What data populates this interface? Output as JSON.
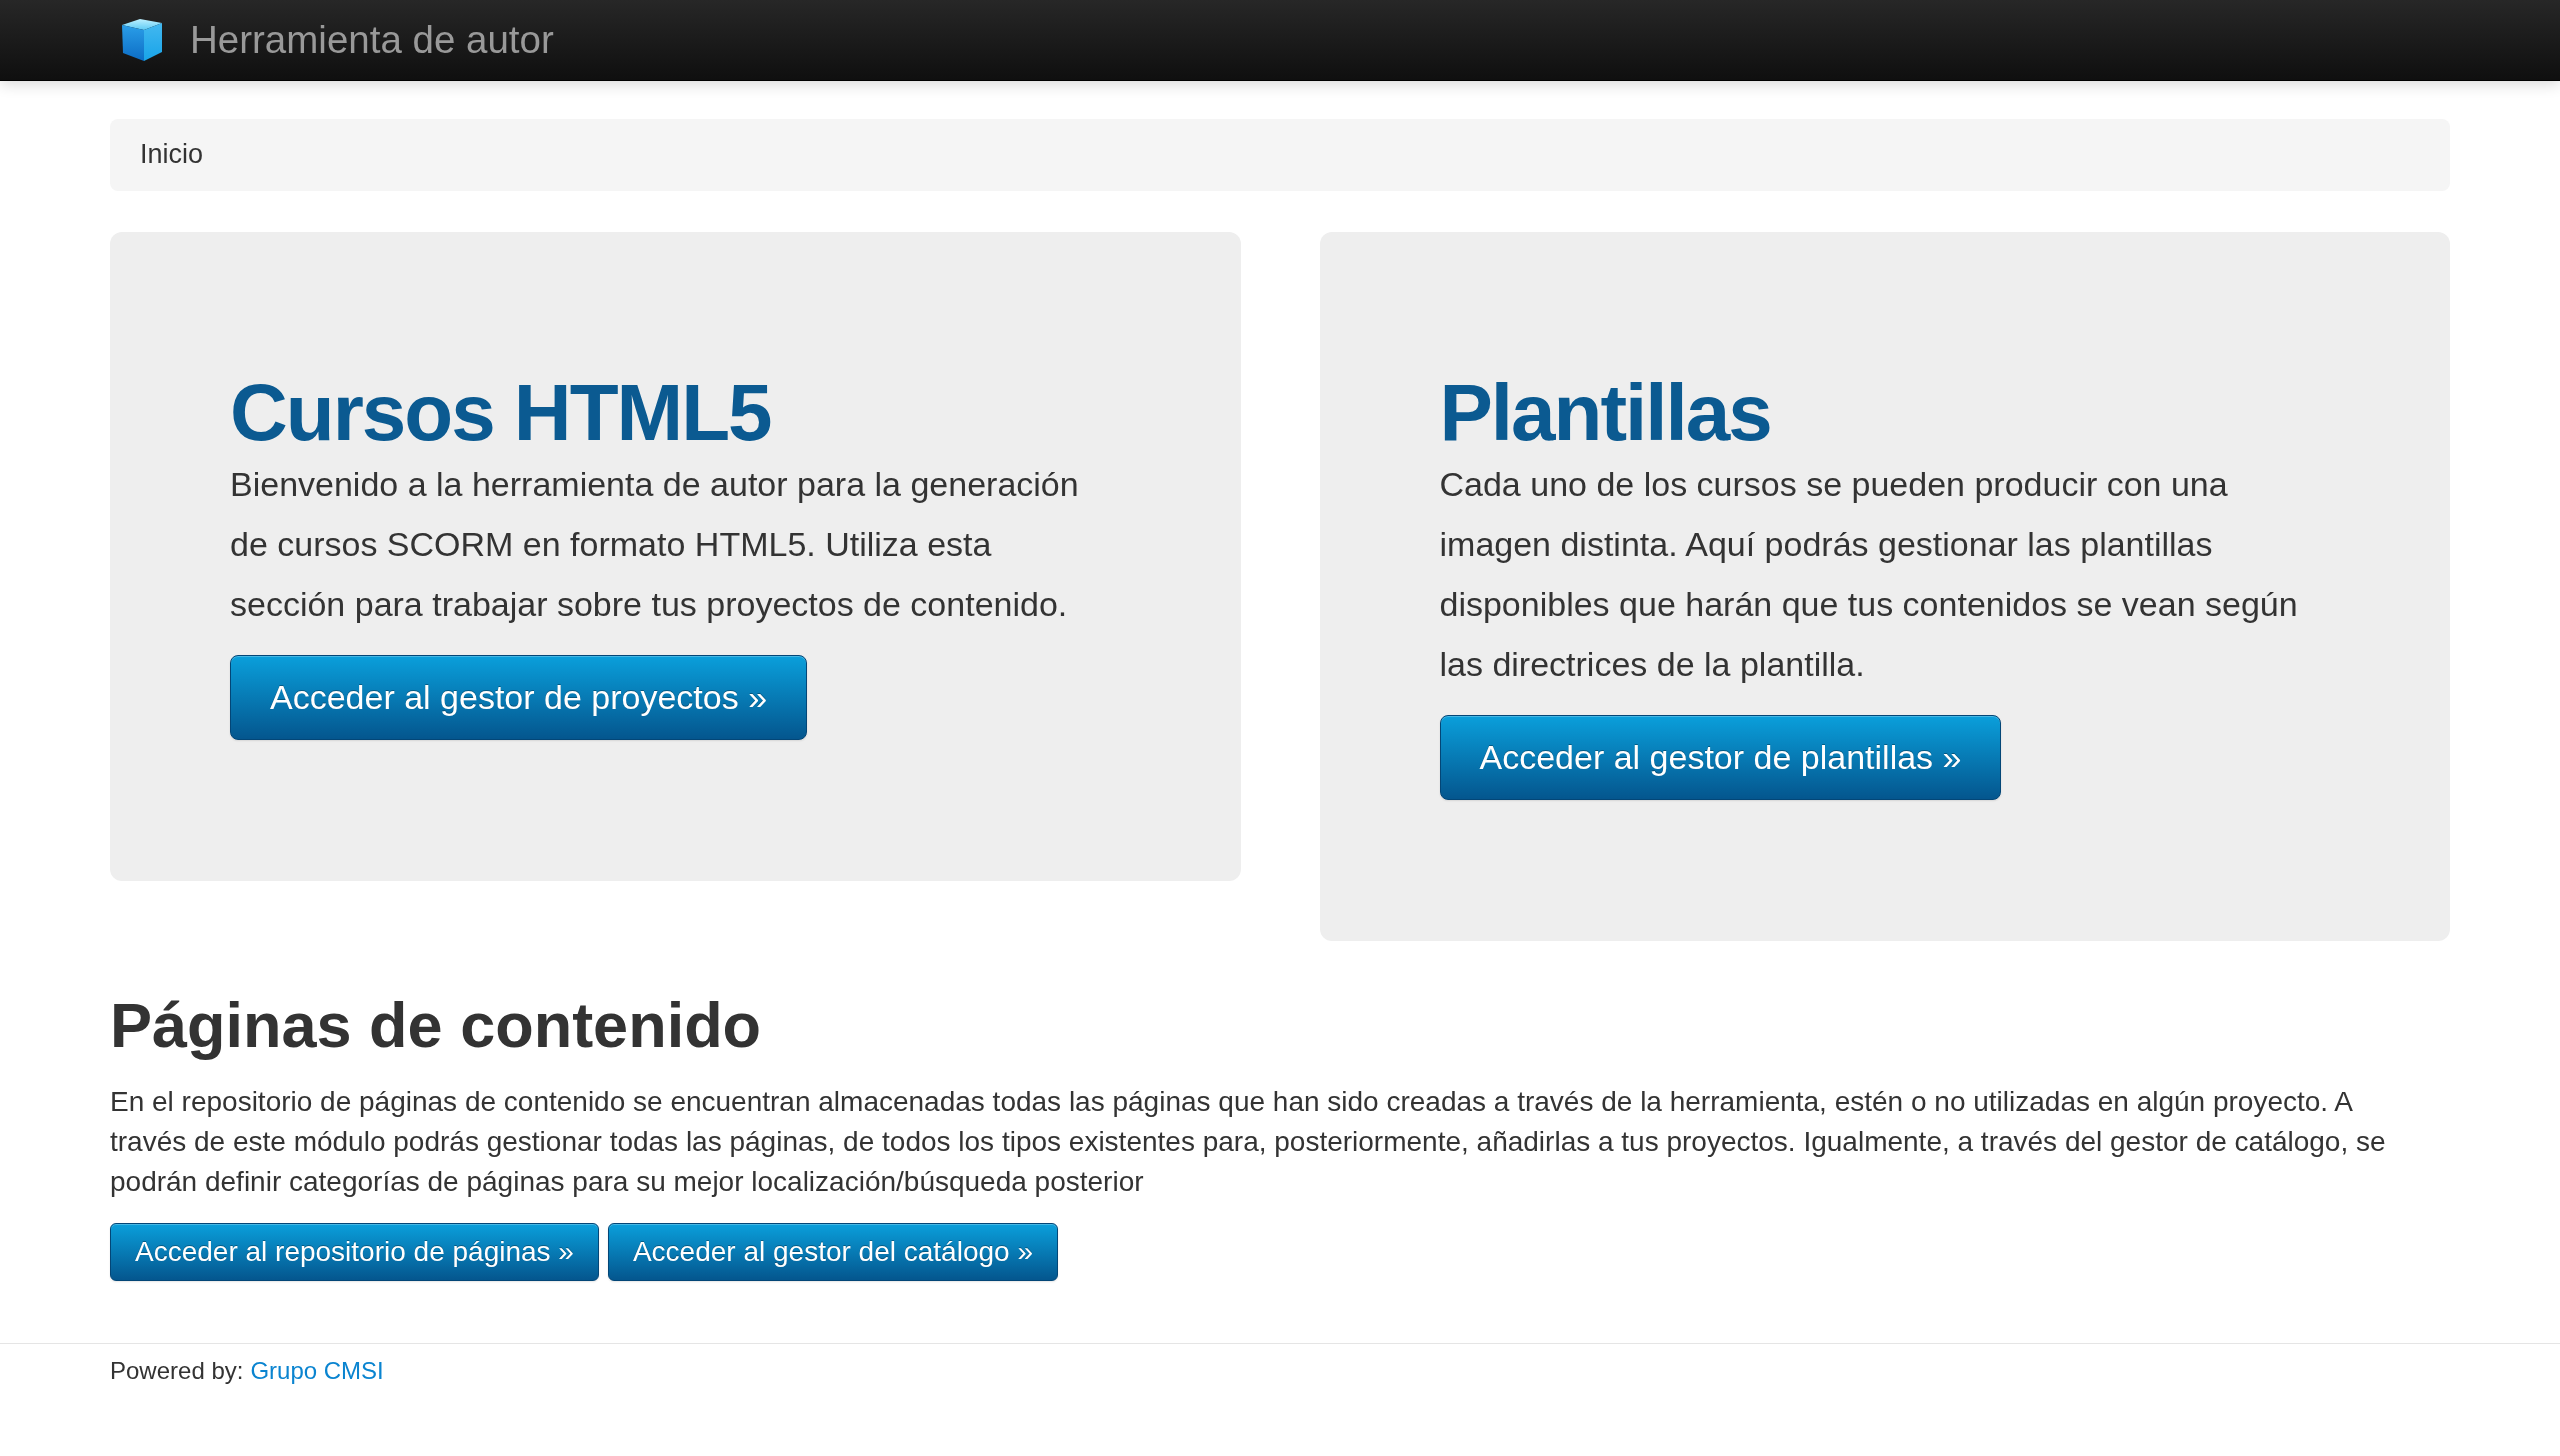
{
  "navbar": {
    "brand": "Herramienta de autor"
  },
  "breadcrumb": [
    "Inicio"
  ],
  "hero_units": [
    {
      "title": "Cursos HTML5",
      "text": "Bienvenido a la herramienta de autor para la generación de cursos SCORM en formato HTML5. Utiliza esta sección para trabajar sobre tus proyectos de contenido.",
      "button": "Acceder al gestor de proyectos »"
    },
    {
      "title": "Plantillas",
      "text": "Cada uno de los cursos se pueden producir con una imagen distinta. Aquí podrás gestionar las plantillas disponibles que harán que tus contenidos se vean según las directrices de la plantilla.",
      "button": "Acceder al gestor de plantillas »"
    }
  ],
  "section": {
    "title": "Páginas de contenido",
    "text": "En el repositorio de páginas de contenido se encuentran almacenadas todas las páginas que han sido creadas a través de la herramienta, estén o no utilizadas en algún proyecto. A través de este módulo podrás gestionar todas las páginas, de todos los tipos existentes para, posteriormente, añadirlas a tus proyectos. Igualmente, a través del gestor de catálogo, se podrán definir categorías de páginas para su mejor localización/búsqueda posterior",
    "buttons": [
      "Acceder al repositorio de páginas »",
      "Acceder al gestor del catálogo »"
    ]
  },
  "footer": {
    "label": "Powered by:",
    "link": "Grupo CMSI"
  }
}
